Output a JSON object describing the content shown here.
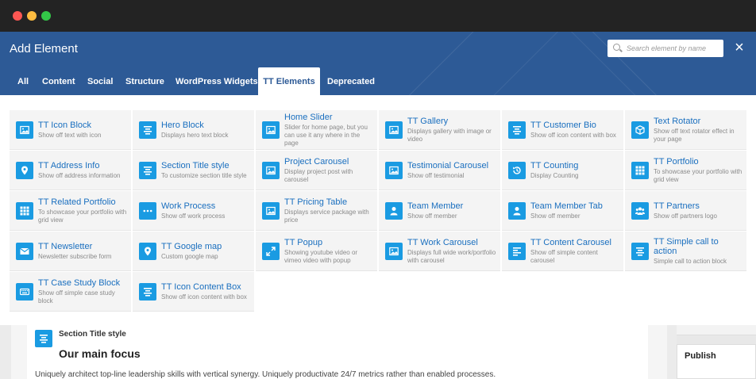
{
  "modal": {
    "title": "Add Element",
    "search_placeholder": "Search element by name",
    "close_label": "×"
  },
  "tabs": [
    {
      "label": "All"
    },
    {
      "label": "Content"
    },
    {
      "label": "Social"
    },
    {
      "label": "Structure"
    },
    {
      "label": "WordPress Widgets"
    },
    {
      "label": "TT Elements",
      "active": true
    },
    {
      "label": "Deprecated"
    }
  ],
  "elements": [
    {
      "title": "TT Icon Block",
      "desc": "Show off text with icon",
      "icon": "image-icon"
    },
    {
      "title": "Hero Block",
      "desc": "Displays hero text block",
      "icon": "align-center-icon"
    },
    {
      "title": "Home Slider",
      "desc": "Slider for home page, but you can use it any where in the page",
      "icon": "image-icon"
    },
    {
      "title": "TT Gallery",
      "desc": "Displays gallery with image or video",
      "icon": "image-icon"
    },
    {
      "title": "TT Customer Bio",
      "desc": "Show off icon content with box",
      "icon": "align-center-icon"
    },
    {
      "title": "Text Rotator",
      "desc": "Show off text rotator effect in your page",
      "icon": "cube-icon"
    },
    {
      "title": "TT Address Info",
      "desc": "Show off address information",
      "icon": "map-marker-icon"
    },
    {
      "title": "Section Title style",
      "desc": "To customize section title style",
      "icon": "align-center-icon"
    },
    {
      "title": "Project Carousel",
      "desc": "Display project post with carousel",
      "icon": "image-icon"
    },
    {
      "title": "Testimonial Carousel",
      "desc": "Show off testimonial",
      "icon": "image-icon"
    },
    {
      "title": "TT Counting",
      "desc": "Display Counting",
      "icon": "history-icon"
    },
    {
      "title": "TT Portfolio",
      "desc": "To showcase your portfolio with grid view",
      "icon": "grid-icon"
    },
    {
      "title": "TT Related Portfolio",
      "desc": "To showcase your portfolio with grid view",
      "icon": "grid-icon"
    },
    {
      "title": "Work Process",
      "desc": "Show off work process",
      "icon": "dots-icon"
    },
    {
      "title": "TT Pricing Table",
      "desc": "Displays service package with price",
      "icon": "image-icon"
    },
    {
      "title": "Team Member",
      "desc": "Show off member",
      "icon": "user-icon"
    },
    {
      "title": "Team Member Tab",
      "desc": "Show off member",
      "icon": "user-icon"
    },
    {
      "title": "TT Partners",
      "desc": "Show off partners logo",
      "icon": "users-icon"
    },
    {
      "title": "TT Newsletter",
      "desc": "Newsletter subscribe form",
      "icon": "envelope-icon"
    },
    {
      "title": "TT Google map",
      "desc": "Custom google map",
      "icon": "map-marker-icon"
    },
    {
      "title": "TT Popup",
      "desc": "Showing youtube video or vimeo video with popup",
      "icon": "expand-icon"
    },
    {
      "title": "TT Work Carousel",
      "desc": "Displays full wide work/portfolio with carousel",
      "icon": "image-icon"
    },
    {
      "title": "TT Content Carousel",
      "desc": "Show off simple content carousel",
      "icon": "align-left-icon"
    },
    {
      "title": "TT Simple call to action",
      "desc": "Simple call to action block",
      "icon": "align-center-icon"
    },
    {
      "title": "TT Case Study Block",
      "desc": "Show off simple case study block",
      "icon": "keyboard-icon"
    },
    {
      "title": "TT Icon Content Box",
      "desc": "Show off icon content with box",
      "icon": "align-center-icon"
    }
  ],
  "background": {
    "section_label": "Section Title style",
    "heading": "Our main focus",
    "paragraph": "Uniquely architect top-line leadership skills with vertical synergy. Uniquely productivate 24/7 metrics rather than enabled processes.",
    "publish_label": "Publish"
  }
}
